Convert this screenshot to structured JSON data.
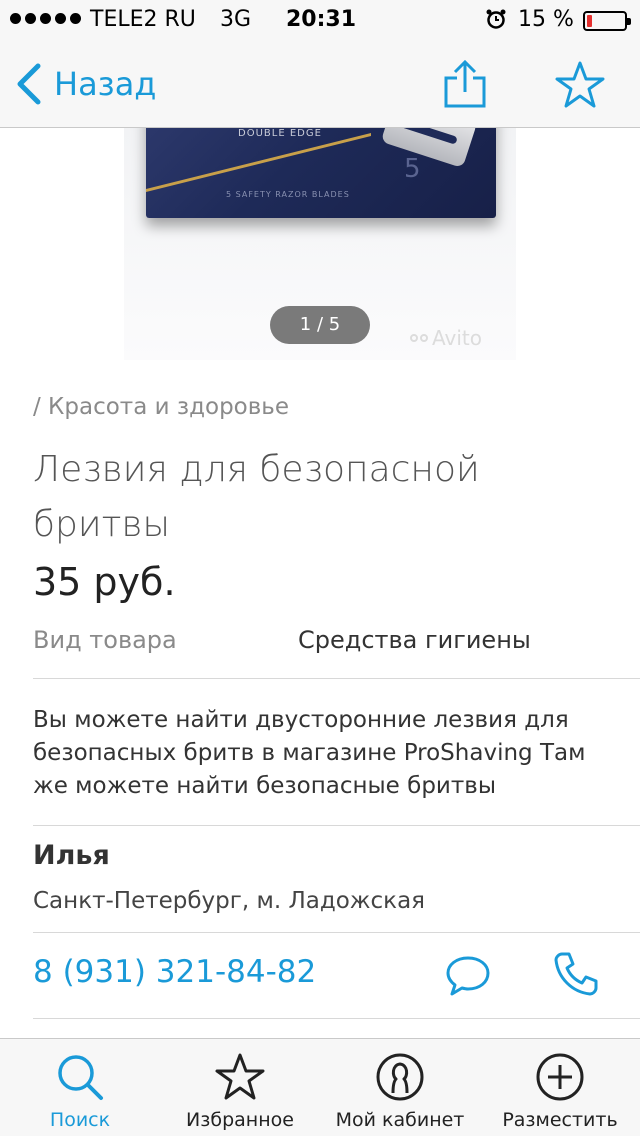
{
  "status_bar": {
    "carrier": "TELE2 RU",
    "network": "3G",
    "time": "20:31",
    "battery_percent": "15 %",
    "battery_level": 0.15
  },
  "nav": {
    "back_label": "Назад",
    "share_icon": "share-icon",
    "favorite_icon": "star-icon"
  },
  "gallery": {
    "pager": "1 / 5",
    "watermark": "Avito",
    "box_label": "DOUBLE EDGE",
    "box_small": "5 SAFETY RAZOR BLADES",
    "box_count": "5"
  },
  "listing": {
    "category": "/ Красота и здоровье",
    "title": "Лезвия для безопасной бритвы",
    "price": "35 руб.",
    "param_label": "Вид товара",
    "param_value": "Средства гигиены",
    "description": "Вы можете найти двусторонние лезвия для безопасных бритв в магазине ProShaving Там же можете найти безопасные бритвы"
  },
  "seller": {
    "name": "Илья",
    "location": "Санкт-Петербург, м. Ладожская",
    "phone": "8 (931) 321-84-82"
  },
  "tabs": [
    {
      "label": "Поиск",
      "icon": "search-icon",
      "active": true
    },
    {
      "label": "Избранное",
      "icon": "star-icon",
      "active": false
    },
    {
      "label": "Мой кабинет",
      "icon": "profile-icon",
      "active": false
    },
    {
      "label": "Разместить",
      "icon": "plus-icon",
      "active": false
    }
  ],
  "colors": {
    "accent": "#1a9ad8",
    "battery_low": "#e5302f"
  }
}
